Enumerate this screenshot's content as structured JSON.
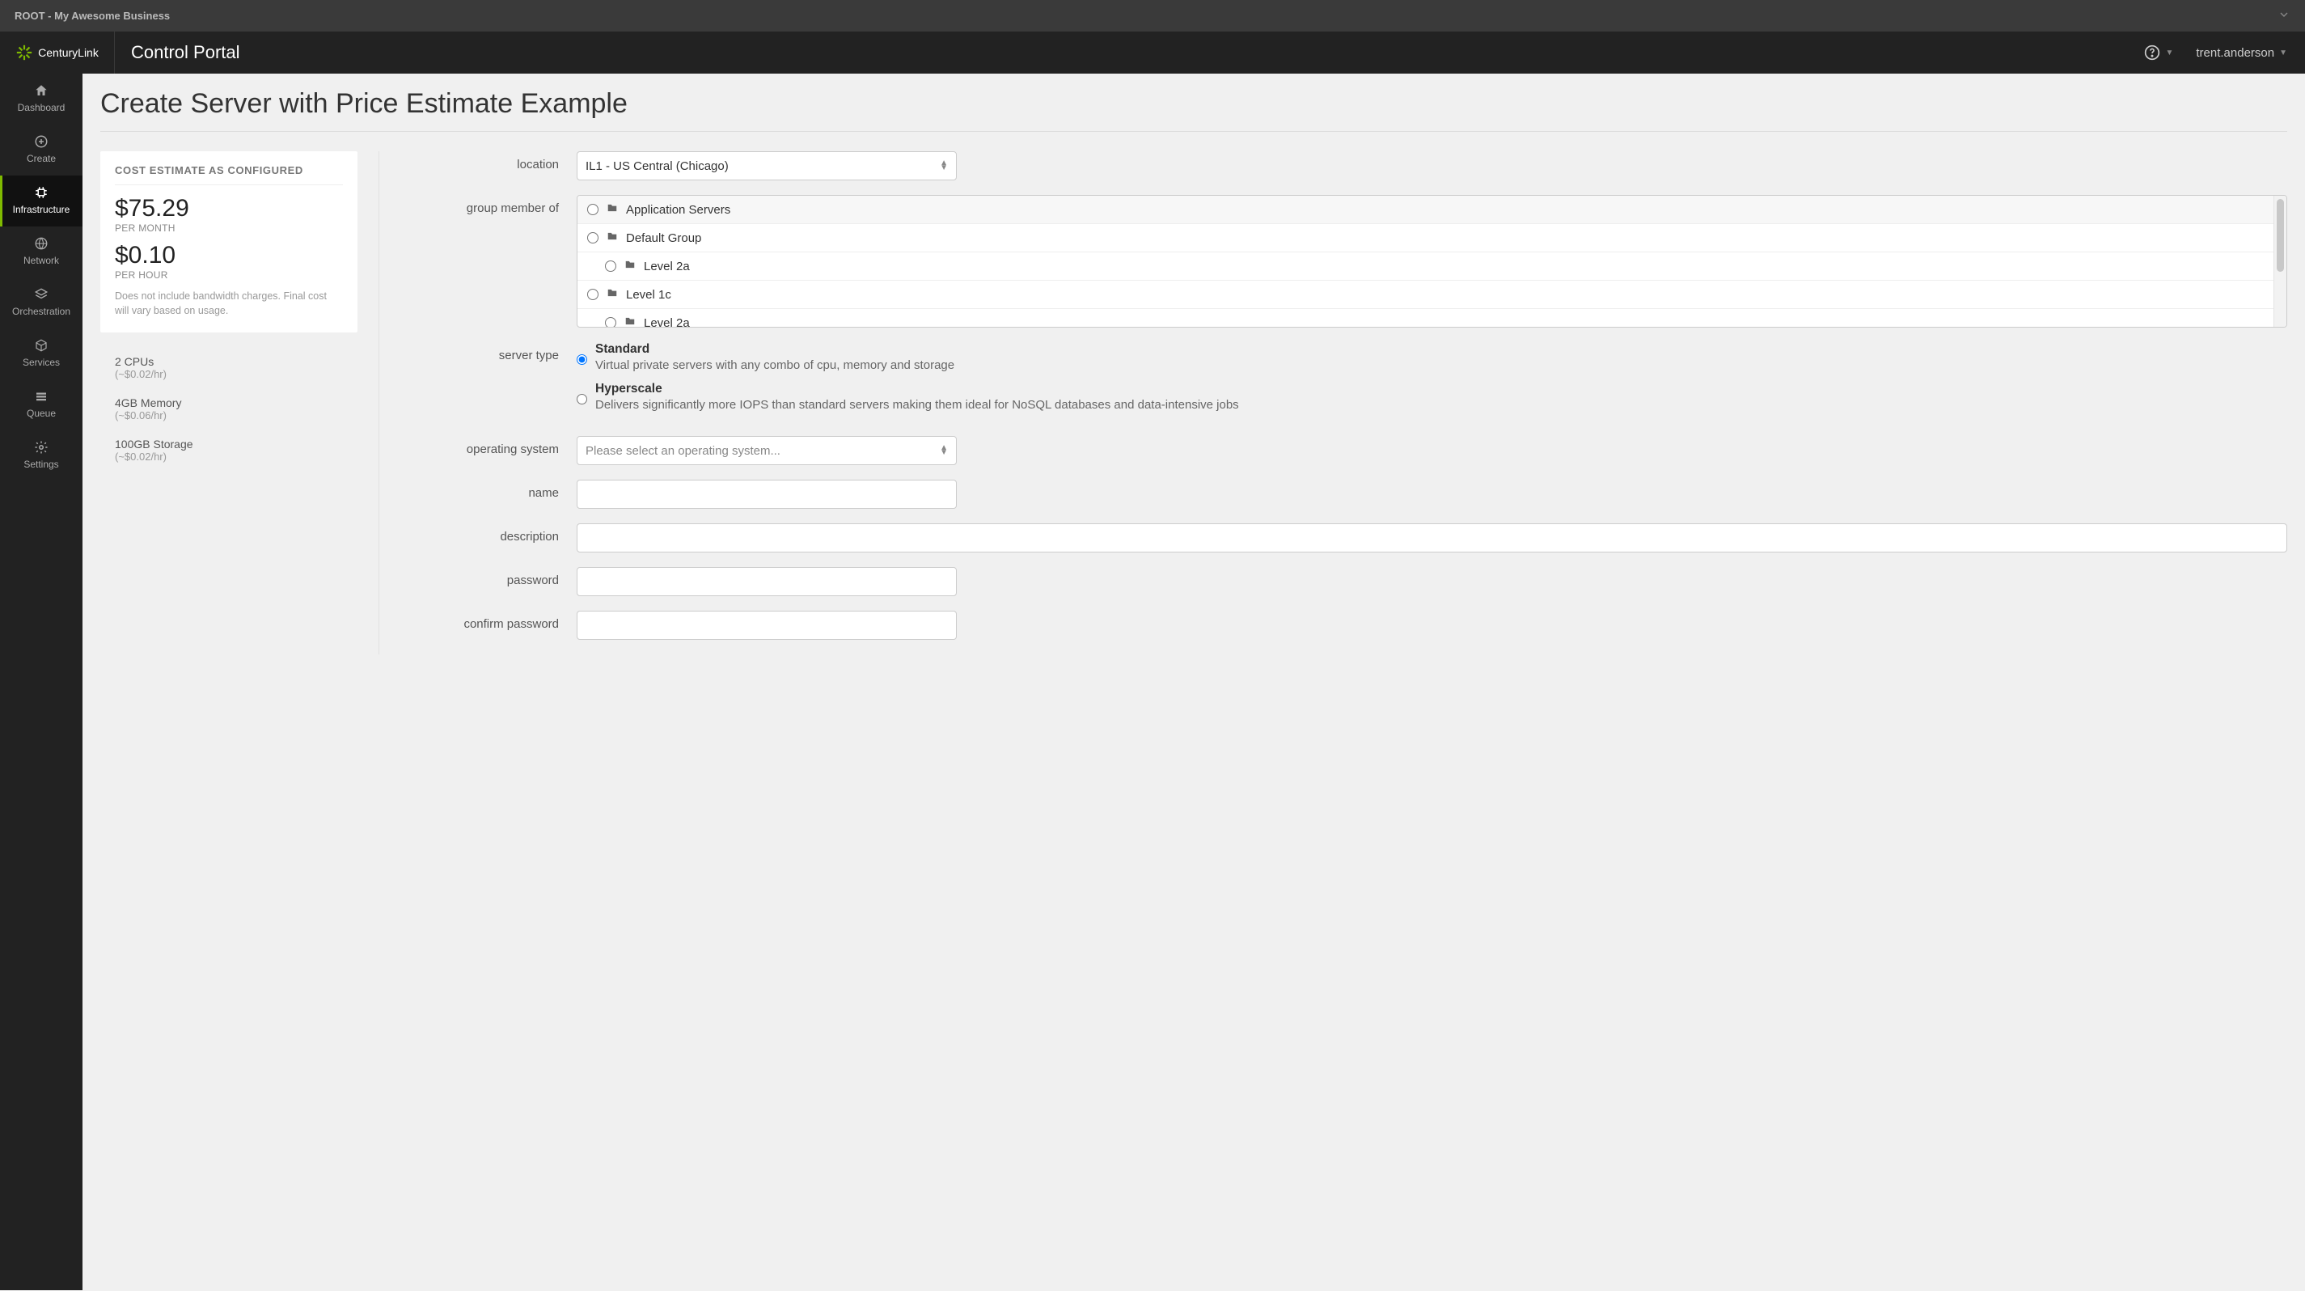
{
  "breadcrumb": "ROOT - My Awesome Business",
  "brand_name": "CenturyLink",
  "portal_title": "Control Portal",
  "user_name": "trent.anderson",
  "nav": [
    {
      "label": "Dashboard"
    },
    {
      "label": "Create"
    },
    {
      "label": "Infrastructure"
    },
    {
      "label": "Network"
    },
    {
      "label": "Orchestration"
    },
    {
      "label": "Services"
    },
    {
      "label": "Queue"
    },
    {
      "label": "Settings"
    }
  ],
  "page_title": "Create Server with Price Estimate Example",
  "estimate": {
    "heading": "COST ESTIMATE AS CONFIGURED",
    "per_month_price": "$75.29",
    "per_month_label": "PER MONTH",
    "per_hour_price": "$0.10",
    "per_hour_label": "PER HOUR",
    "disclaimer": "Does not include bandwidth charges. Final cost will vary based on usage."
  },
  "resources": [
    {
      "title": "2 CPUs",
      "sub": "(~$0.02/hr)"
    },
    {
      "title": "4GB Memory",
      "sub": "(~$0.06/hr)"
    },
    {
      "title": "100GB Storage",
      "sub": "(~$0.02/hr)"
    }
  ],
  "form": {
    "labels": {
      "location": "location",
      "group": "group member of",
      "server_type": "server type",
      "os": "operating system",
      "name": "name",
      "description": "description",
      "password": "password",
      "confirm": "confirm password"
    },
    "location_value": "IL1 - US Central (Chicago)",
    "groups": [
      {
        "label": "Application Servers",
        "indent": false
      },
      {
        "label": "Default Group",
        "indent": false
      },
      {
        "label": "Level 2a",
        "indent": true
      },
      {
        "label": "Level 1c",
        "indent": false
      },
      {
        "label": "Level 2a",
        "indent": true
      }
    ],
    "server_types": [
      {
        "title": "Standard",
        "desc": "Virtual private servers with any combo of cpu, memory and storage",
        "checked": true
      },
      {
        "title": "Hyperscale",
        "desc": "Delivers significantly more IOPS than standard servers making them ideal for NoSQL databases and data-intensive jobs",
        "checked": false
      }
    ],
    "os_placeholder": "Please select an operating system..."
  }
}
